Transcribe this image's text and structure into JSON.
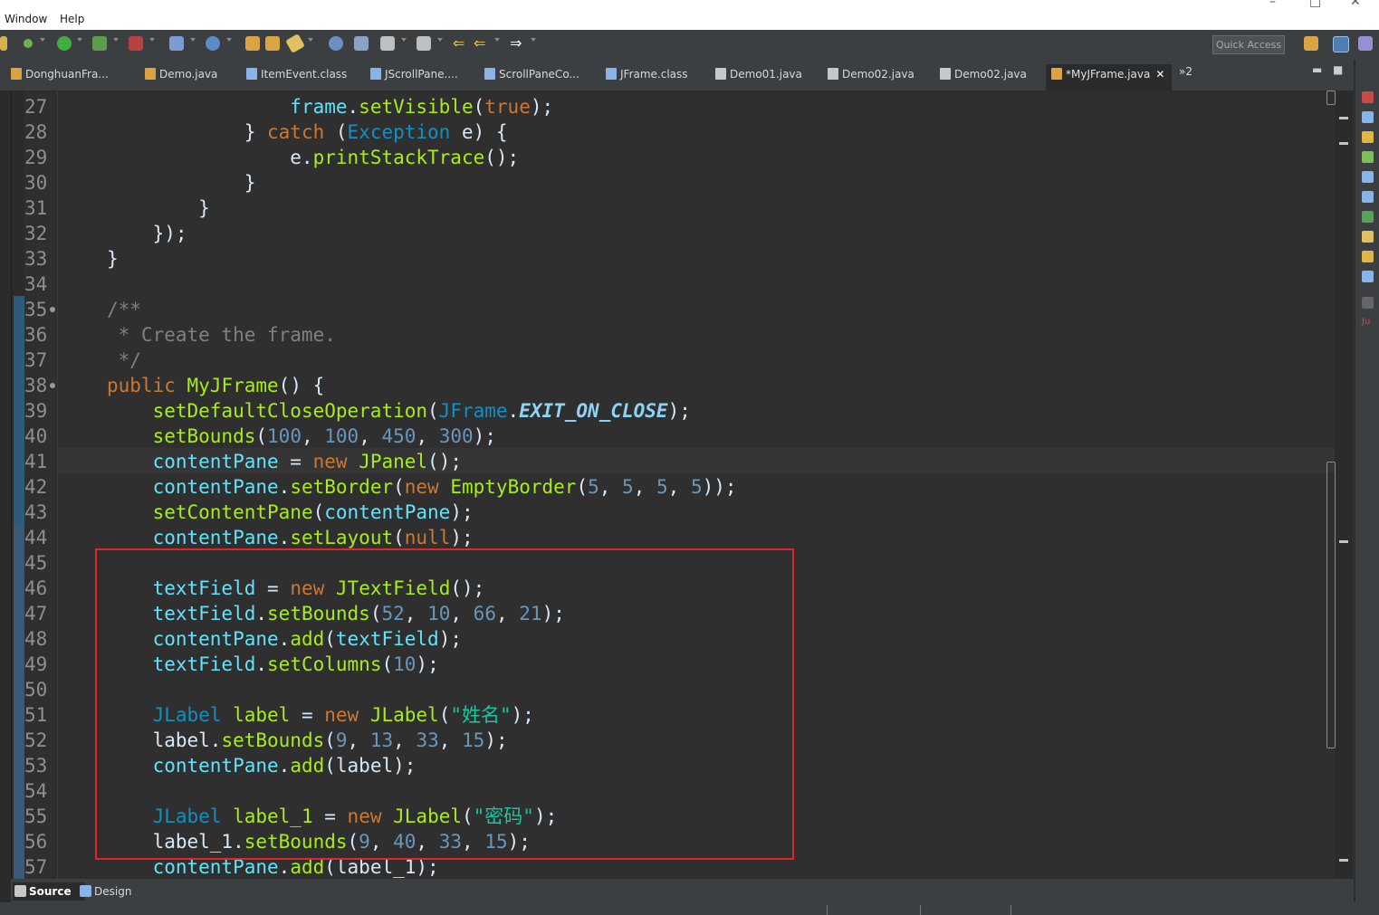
{
  "menubar": {
    "items": [
      "Window",
      "Help"
    ],
    "window_controls": {
      "minimize": "–",
      "maximize": "□",
      "close": "✕"
    }
  },
  "toolbar": {
    "quick_access": "Quick Access"
  },
  "tabs": [
    {
      "label": "DonghuanFra...",
      "icon": "java-class-icon",
      "color": "#d9a441"
    },
    {
      "label": "Demo.java",
      "icon": "java-class-icon",
      "color": "#d9a441"
    },
    {
      "label": "ItemEvent.class",
      "icon": "class-file-icon",
      "color": "#8ab4e8"
    },
    {
      "label": "JScrollPane....",
      "icon": "class-file-icon",
      "color": "#8ab4e8"
    },
    {
      "label": "ScrollPaneCo...",
      "icon": "class-file-icon",
      "color": "#8ab4e8"
    },
    {
      "label": "JFrame.class",
      "icon": "class-file-icon",
      "color": "#8ab4e8"
    },
    {
      "label": "Demo01.java",
      "icon": "java-file-icon",
      "color": "#c8c8c8"
    },
    {
      "label": "Demo02.java",
      "icon": "java-file-icon",
      "color": "#c8c8c8"
    },
    {
      "label": "Demo02.java",
      "icon": "java-file-icon",
      "color": "#c8c8c8"
    },
    {
      "label": "*MyJFrame.java",
      "icon": "java-class-icon",
      "color": "#d9a441",
      "active": true
    }
  ],
  "tab_overflow": "»2",
  "line_numbers": [
    "27",
    "28",
    "29",
    "30",
    "31",
    "32",
    "33",
    "34",
    "35",
    "36",
    "37",
    "38",
    "39",
    "40",
    "41",
    "42",
    "43",
    "44",
    "45",
    "46",
    "47",
    "48",
    "49",
    "50",
    "51",
    "52",
    "53",
    "54",
    "55",
    "56",
    "57"
  ],
  "code_lines": [
    [
      [
        "                ",
        ""
      ],
      [
        "frame",
        "v"
      ],
      [
        ".",
        ""
      ],
      [
        "setVisible",
        "f"
      ],
      [
        "(",
        ""
      ],
      [
        "true",
        "k"
      ],
      [
        ");",
        ""
      ]
    ],
    [
      [
        "            } ",
        ""
      ],
      [
        "catch",
        "k"
      ],
      [
        " (",
        ""
      ],
      [
        "Exception",
        "t"
      ],
      [
        " e) {",
        ""
      ]
    ],
    [
      [
        "                e.",
        ""
      ],
      [
        "printStackTrace",
        "f"
      ],
      [
        "();",
        ""
      ]
    ],
    [
      [
        "            }",
        ""
      ]
    ],
    [
      [
        "        }",
        ""
      ]
    ],
    [
      [
        "    });",
        ""
      ]
    ],
    [
      [
        "}",
        ""
      ]
    ],
    [
      [
        "",
        ""
      ]
    ],
    [
      [
        "/**",
        "c"
      ]
    ],
    [
      [
        " * Create the frame.",
        "c"
      ]
    ],
    [
      [
        " */",
        "c"
      ]
    ],
    [
      [
        "public",
        "k"
      ],
      [
        " ",
        ""
      ],
      [
        "MyJFrame",
        "f"
      ],
      [
        "() {",
        ""
      ]
    ],
    [
      [
        "    ",
        ""
      ],
      [
        "setDefaultCloseOperation",
        "f"
      ],
      [
        "(",
        ""
      ],
      [
        "JFrame",
        "t"
      ],
      [
        ".",
        ""
      ],
      [
        "EXIT_ON_CLOSE",
        "st"
      ],
      [
        ");",
        ""
      ]
    ],
    [
      [
        "    ",
        ""
      ],
      [
        "setBounds",
        "f"
      ],
      [
        "(",
        ""
      ],
      [
        "100",
        "n"
      ],
      [
        ", ",
        ""
      ],
      [
        "100",
        "n"
      ],
      [
        ", ",
        ""
      ],
      [
        "450",
        "n"
      ],
      [
        ", ",
        ""
      ],
      [
        "300",
        "n"
      ],
      [
        ");",
        ""
      ]
    ],
    [
      [
        "    ",
        ""
      ],
      [
        "contentPane",
        "v"
      ],
      [
        " = ",
        ""
      ],
      [
        "new",
        "k"
      ],
      [
        " ",
        ""
      ],
      [
        "JPanel",
        "f"
      ],
      [
        "();",
        ""
      ]
    ],
    [
      [
        "    ",
        ""
      ],
      [
        "contentPane",
        "v"
      ],
      [
        ".",
        ""
      ],
      [
        "setBorder",
        "f"
      ],
      [
        "(",
        ""
      ],
      [
        "new",
        "k"
      ],
      [
        " ",
        ""
      ],
      [
        "EmptyBorder",
        "f"
      ],
      [
        "(",
        ""
      ],
      [
        "5",
        "n"
      ],
      [
        ", ",
        ""
      ],
      [
        "5",
        "n"
      ],
      [
        ", ",
        ""
      ],
      [
        "5",
        "n"
      ],
      [
        ", ",
        ""
      ],
      [
        "5",
        "n"
      ],
      [
        "));",
        ""
      ]
    ],
    [
      [
        "    ",
        ""
      ],
      [
        "setContentPane",
        "f"
      ],
      [
        "(",
        ""
      ],
      [
        "contentPane",
        "v"
      ],
      [
        ");",
        ""
      ]
    ],
    [
      [
        "    ",
        ""
      ],
      [
        "contentPane",
        "v"
      ],
      [
        ".",
        ""
      ],
      [
        "setLayout",
        "f"
      ],
      [
        "(",
        ""
      ],
      [
        "null",
        "k"
      ],
      [
        ");",
        ""
      ]
    ],
    [
      [
        "",
        ""
      ]
    ],
    [
      [
        "    ",
        ""
      ],
      [
        "textField",
        "v"
      ],
      [
        " = ",
        ""
      ],
      [
        "new",
        "k"
      ],
      [
        " ",
        ""
      ],
      [
        "JTextField",
        "f"
      ],
      [
        "();",
        ""
      ]
    ],
    [
      [
        "    ",
        ""
      ],
      [
        "textField",
        "v"
      ],
      [
        ".",
        ""
      ],
      [
        "setBounds",
        "f"
      ],
      [
        "(",
        ""
      ],
      [
        "52",
        "n"
      ],
      [
        ", ",
        ""
      ],
      [
        "10",
        "n"
      ],
      [
        ", ",
        ""
      ],
      [
        "66",
        "n"
      ],
      [
        ", ",
        ""
      ],
      [
        "21",
        "n"
      ],
      [
        ");",
        ""
      ]
    ],
    [
      [
        "    ",
        ""
      ],
      [
        "contentPane",
        "v"
      ],
      [
        ".",
        ""
      ],
      [
        "add",
        "f"
      ],
      [
        "(",
        ""
      ],
      [
        "textField",
        "v"
      ],
      [
        ");",
        ""
      ]
    ],
    [
      [
        "    ",
        ""
      ],
      [
        "textField",
        "v"
      ],
      [
        ".",
        ""
      ],
      [
        "setColumns",
        "f"
      ],
      [
        "(",
        ""
      ],
      [
        "10",
        "n"
      ],
      [
        ");",
        ""
      ]
    ],
    [
      [
        "",
        ""
      ]
    ],
    [
      [
        "    ",
        ""
      ],
      [
        "JLabel",
        "t"
      ],
      [
        " ",
        ""
      ],
      [
        "label",
        "f"
      ],
      [
        " = ",
        ""
      ],
      [
        "new",
        "k"
      ],
      [
        " ",
        ""
      ],
      [
        "JLabel",
        "f"
      ],
      [
        "(",
        ""
      ],
      [
        "\"姓名\"",
        "s"
      ],
      [
        ");",
        ""
      ]
    ],
    [
      [
        "    label.",
        ""
      ],
      [
        "setBounds",
        "f"
      ],
      [
        "(",
        ""
      ],
      [
        "9",
        "n"
      ],
      [
        ", ",
        ""
      ],
      [
        "13",
        "n"
      ],
      [
        ", ",
        ""
      ],
      [
        "33",
        "n"
      ],
      [
        ", ",
        ""
      ],
      [
        "15",
        "n"
      ],
      [
        ");",
        ""
      ]
    ],
    [
      [
        "    ",
        ""
      ],
      [
        "contentPane",
        "v"
      ],
      [
        ".",
        ""
      ],
      [
        "add",
        "f"
      ],
      [
        "(label);",
        ""
      ]
    ],
    [
      [
        "",
        ""
      ]
    ],
    [
      [
        "    ",
        ""
      ],
      [
        "JLabel",
        "t"
      ],
      [
        " ",
        ""
      ],
      [
        "label_1",
        "f"
      ],
      [
        " = ",
        ""
      ],
      [
        "new",
        "k"
      ],
      [
        " ",
        ""
      ],
      [
        "JLabel",
        "f"
      ],
      [
        "(",
        ""
      ],
      [
        "\"密码\"",
        "s"
      ],
      [
        ");",
        ""
      ]
    ],
    [
      [
        "    label_1.",
        ""
      ],
      [
        "setBounds",
        "f"
      ],
      [
        "(",
        ""
      ],
      [
        "9",
        "n"
      ],
      [
        ", ",
        ""
      ],
      [
        "40",
        "n"
      ],
      [
        ", ",
        ""
      ],
      [
        "33",
        "n"
      ],
      [
        ", ",
        ""
      ],
      [
        "15",
        "n"
      ],
      [
        ");",
        ""
      ]
    ],
    [
      [
        "    ",
        ""
      ],
      [
        "contentPane",
        "v"
      ],
      [
        ".",
        ""
      ],
      [
        "add",
        "f"
      ],
      [
        "(label_1);",
        ""
      ]
    ]
  ],
  "bottom_tabs": [
    {
      "label": "Source",
      "active": true
    },
    {
      "label": "Design"
    }
  ],
  "colors": {
    "highlight_box": "#e0262a",
    "keyword": "#cc7832",
    "method": "#a7ec21",
    "field": "#66e1f8",
    "type": "#1290c3",
    "number": "#6897bb",
    "string": "#17c6a3",
    "comment": "#808080"
  }
}
